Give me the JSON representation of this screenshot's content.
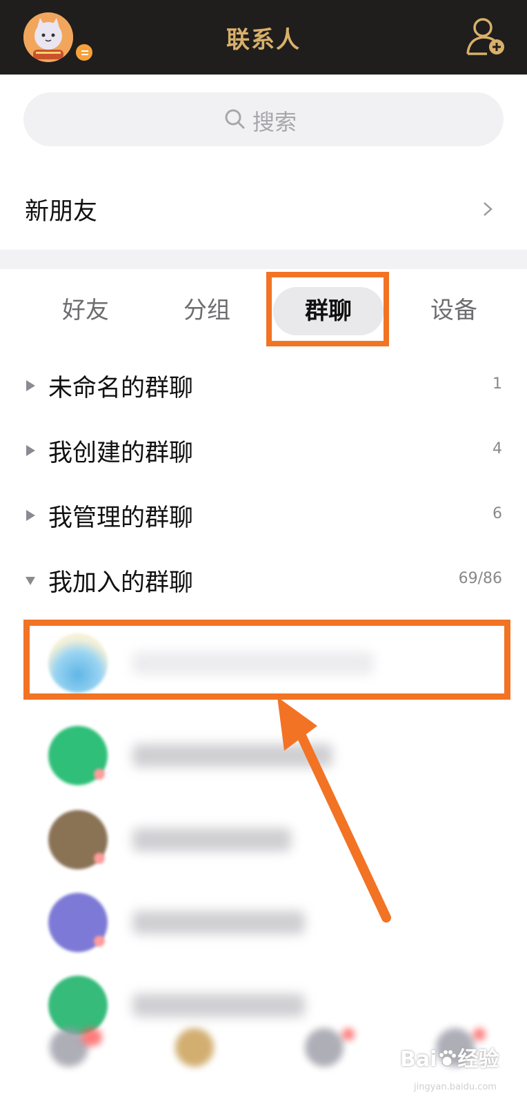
{
  "header": {
    "title": "联系人",
    "icons": [
      "avatar",
      "add-contact-icon"
    ],
    "colors": {
      "bar": "#1f1e1d",
      "title": "#d9b06a"
    }
  },
  "search": {
    "placeholder": "搜索",
    "icon": "search-icon"
  },
  "new_friends": {
    "label": "新朋友"
  },
  "tabs": [
    {
      "label": "好友",
      "active": false
    },
    {
      "label": "分组",
      "active": false
    },
    {
      "label": "群聊",
      "active": true
    },
    {
      "label": "设备",
      "active": false
    }
  ],
  "groups": [
    {
      "label": "未命名的群聊",
      "count": "1",
      "expanded": false
    },
    {
      "label": "我创建的群聊",
      "count": "4",
      "expanded": false
    },
    {
      "label": "我管理的群聊",
      "count": "6",
      "expanded": false
    },
    {
      "label": "我加入的群聊",
      "count": "69/86",
      "expanded": true
    }
  ],
  "annotation": {
    "highlight_color": "#f27324"
  },
  "watermark": {
    "brand": "Bai",
    "brand_mid": "经验",
    "url": "jingyan.baidu.com"
  }
}
